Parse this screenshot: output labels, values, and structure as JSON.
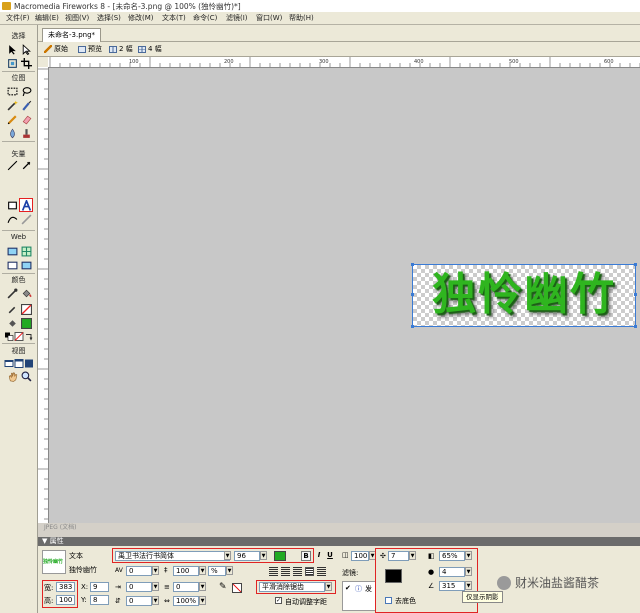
{
  "app": {
    "title": "Macromedia Fireworks 8 - [未命名-3.png @ 100% (独怜幽竹)*]"
  },
  "menu": [
    "文件(F)",
    "编辑(E)",
    "视图(V)",
    "选择(S)",
    "修改(M)",
    "文本(T)",
    "命令(C)",
    "滤镜(I)",
    "窗口(W)",
    "帮助(H)"
  ],
  "tools": {
    "sections": [
      "选择",
      "位图",
      "矢量",
      "Web",
      "颜色",
      "视图"
    ]
  },
  "document": {
    "tab_label": "未命名-3.png*",
    "view_buttons": [
      "原始",
      "预览",
      "2 幅",
      "4 幅"
    ],
    "ruler_ticks": [
      "100",
      "200",
      "300",
      "400",
      "500",
      "600"
    ],
    "status": "JPEG (文档)",
    "text_content": "独怜幽竹",
    "text_color": "#2fb51f"
  },
  "properties": {
    "header": "▼ 属性",
    "object_type": "文本",
    "object_name": "独怜幽竹",
    "thumb_text": "独怜幽竹",
    "font": "禹卫书法行书简体",
    "size": "96",
    "fill_color": "#22aa22",
    "bold_label": "B",
    "italic_label": "I",
    "underline_label": "U",
    "kerning_label": "AV",
    "kerning": "0",
    "leading": "100",
    "leading_unit": "%",
    "baseline_shift": "0",
    "horizontal_scale": "100%",
    "indent": "0",
    "space_after": "0",
    "antialias": "平滑消除锯齿",
    "auto_kern": "自动调整字距",
    "width_label": "宽:",
    "width": "383",
    "height_label": "高:",
    "height": "100",
    "x_label": "X:",
    "x": "9",
    "y_label": "Y:",
    "y": "8",
    "opacity": "100",
    "filters_label": "滤镜:",
    "filter_name": "发",
    "shadow": {
      "distance": "7",
      "opacity": "65%",
      "softness": "4",
      "angle": "315",
      "color": "#000000",
      "knockout_label": "去底色"
    },
    "tooltip": "仅显示阴影"
  },
  "watermark": "财米油盐酱醋茶"
}
